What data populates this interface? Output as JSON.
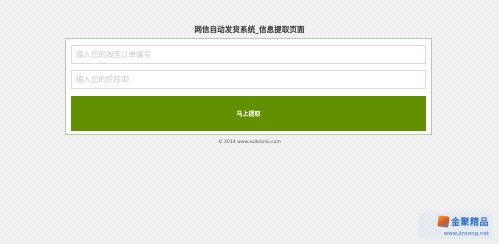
{
  "page": {
    "title": "网信自动发货系统_信息提取页面"
  },
  "form": {
    "order_placeholder": "输入您的淘宝订单编号",
    "order_value": "",
    "wangwang_placeholder": "输入您的旺旺ID",
    "wangwang_value": "",
    "submit_label": "马上提取"
  },
  "footer": {
    "copyright": "© 2014 www.xuibianlu.com"
  },
  "watermark": {
    "name": "金聚精品",
    "url": "www.jincong.net"
  },
  "colors": {
    "accent": "#619100",
    "panel_border": "#a9d3a2",
    "background": "#ededed"
  }
}
